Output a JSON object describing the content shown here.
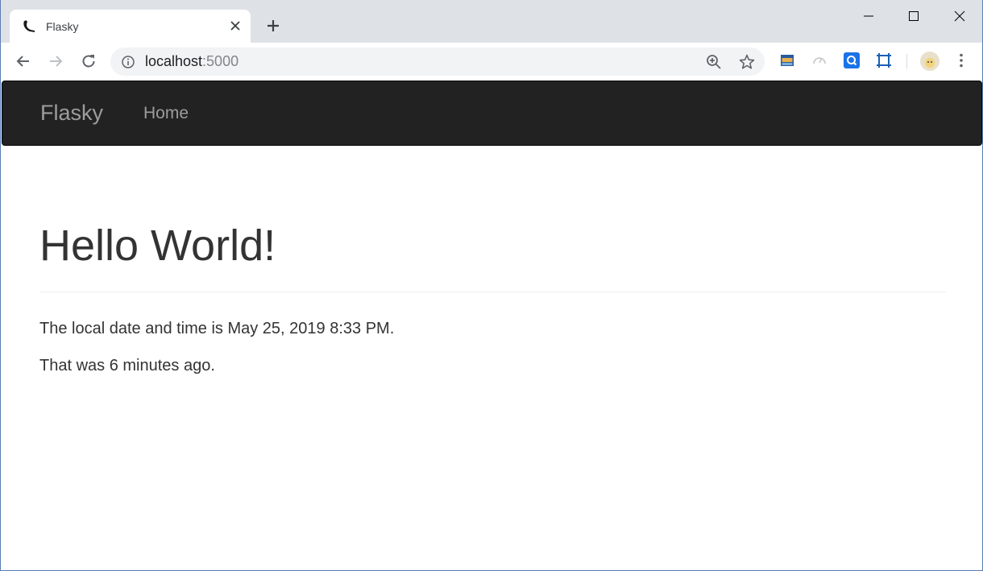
{
  "browser": {
    "tab_title": "Flasky",
    "url_host": "localhost",
    "url_port": ":5000",
    "icons": {
      "favicon": "flask-horn-icon",
      "tab_close": "close-icon",
      "new_tab": "plus-icon",
      "back": "arrow-left-icon",
      "forward": "arrow-right-icon",
      "reload": "reload-icon",
      "site_info": "info-icon",
      "zoom": "zoom-in-icon",
      "bookmark": "star-icon",
      "menu": "kebab-menu-icon"
    },
    "extensions": [
      "extension-calendar-icon",
      "extension-speed-icon",
      "extension-search-icon",
      "extension-crop-icon"
    ],
    "accent_color": "#1a73e8"
  },
  "navbar": {
    "brand": "Flasky",
    "items": [
      {
        "label": "Home"
      }
    ],
    "background": "#222222"
  },
  "main": {
    "heading": "Hello World!",
    "local_time_text": "The local date and time is May 25, 2019 8:33 PM.",
    "relative_time_text": "That was 6 minutes ago."
  }
}
